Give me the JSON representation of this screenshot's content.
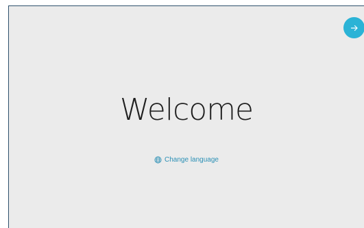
{
  "screen": {
    "title": "Welcome",
    "change_language_label": "Change language",
    "next_icon": "arrow-right-icon",
    "language_icon": "globe-icon"
  },
  "colors": {
    "background": "#ebebeb",
    "accent": "#2bb3d6",
    "link": "#2a8fb5",
    "title_text": "#1f1f1f",
    "frame_border": "#2c4f6b"
  }
}
